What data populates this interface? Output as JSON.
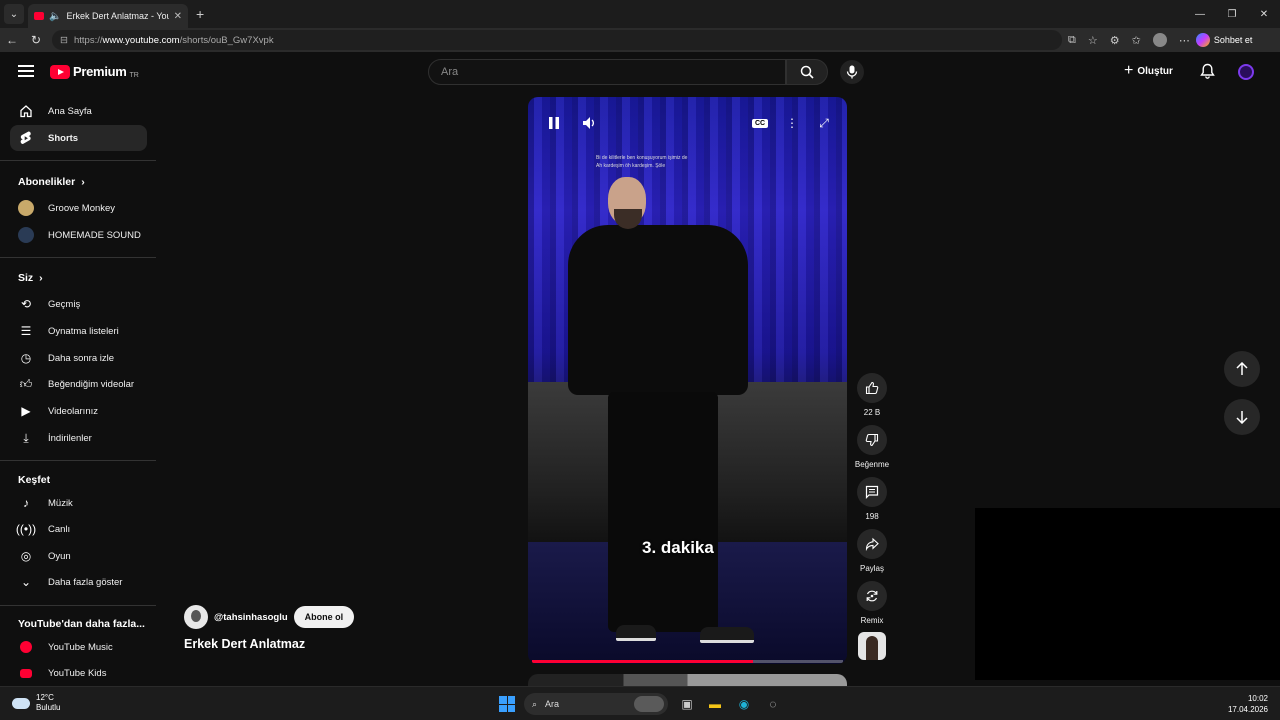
{
  "browser": {
    "tab_title": "Erkek Dert Anlatmaz - YouTube",
    "url_prefix": "https://",
    "url_host": "www.youtube.com",
    "url_path": "/shorts/ouB_Gw7Xvpk",
    "copilot_label": "Sohbet et"
  },
  "header": {
    "logo_text": "Premium",
    "logo_country": "TR",
    "search_placeholder": "Ara",
    "create_label": "Oluştur"
  },
  "sidebar": {
    "main": [
      {
        "label": "Ana Sayfa",
        "icon": "home-icon"
      },
      {
        "label": "Shorts",
        "icon": "shorts-icon"
      }
    ],
    "subs_title": "Abonelikler",
    "subs": [
      {
        "label": "Groove Monkey",
        "color": "#c8a96a"
      },
      {
        "label": "HOMEMADE SOUND",
        "color": "#2a3b55"
      }
    ],
    "you_title": "Siz",
    "you": [
      {
        "label": "Geçmiş",
        "icon": "history-icon"
      },
      {
        "label": "Oynatma listeleri",
        "icon": "playlist-icon"
      },
      {
        "label": "Daha sonra izle",
        "icon": "watch-later-icon"
      },
      {
        "label": "Beğendiğim videolar",
        "icon": "liked-icon"
      },
      {
        "label": "Videolarınız",
        "icon": "your-videos-icon"
      },
      {
        "label": "İndirilenler",
        "icon": "download-icon"
      }
    ],
    "explore_title": "Keşfet",
    "explore": [
      {
        "label": "Müzik",
        "icon": "music-icon"
      },
      {
        "label": "Canlı",
        "icon": "live-icon"
      },
      {
        "label": "Oyun",
        "icon": "gaming-icon"
      },
      {
        "label": "Daha fazla göster",
        "icon": "chevron-down-icon"
      }
    ],
    "more_title": "YouTube'dan daha fazla...",
    "more": [
      {
        "label": "YouTube Music"
      },
      {
        "label": "YouTube Kids"
      }
    ]
  },
  "short": {
    "subtitle": "3. dakika",
    "caption_line1": "Bi de kilitlerle ben konuşuyorum işimiz de",
    "caption_line2": "Ah kardeşim öh kardeşim. Şöle",
    "progress": 0.71,
    "channel": "@tahsinhasoglu",
    "subscribe_label": "Abone ol",
    "title": "Erkek Dert Anlatmaz"
  },
  "actions": {
    "likes": "22 B",
    "dislike_label": "Beğenme",
    "comments": "198",
    "share_label": "Paylaş",
    "remix_label": "Remix"
  },
  "taskbar": {
    "temperature": "12°C",
    "weather": "Bulutlu",
    "search_label": "Ara",
    "time": "10:02",
    "date": "17.04.2026"
  },
  "colors": {
    "brand_red": "#ff0033",
    "background": "#0f0f0f",
    "stage_blue": "#2d23c9"
  }
}
